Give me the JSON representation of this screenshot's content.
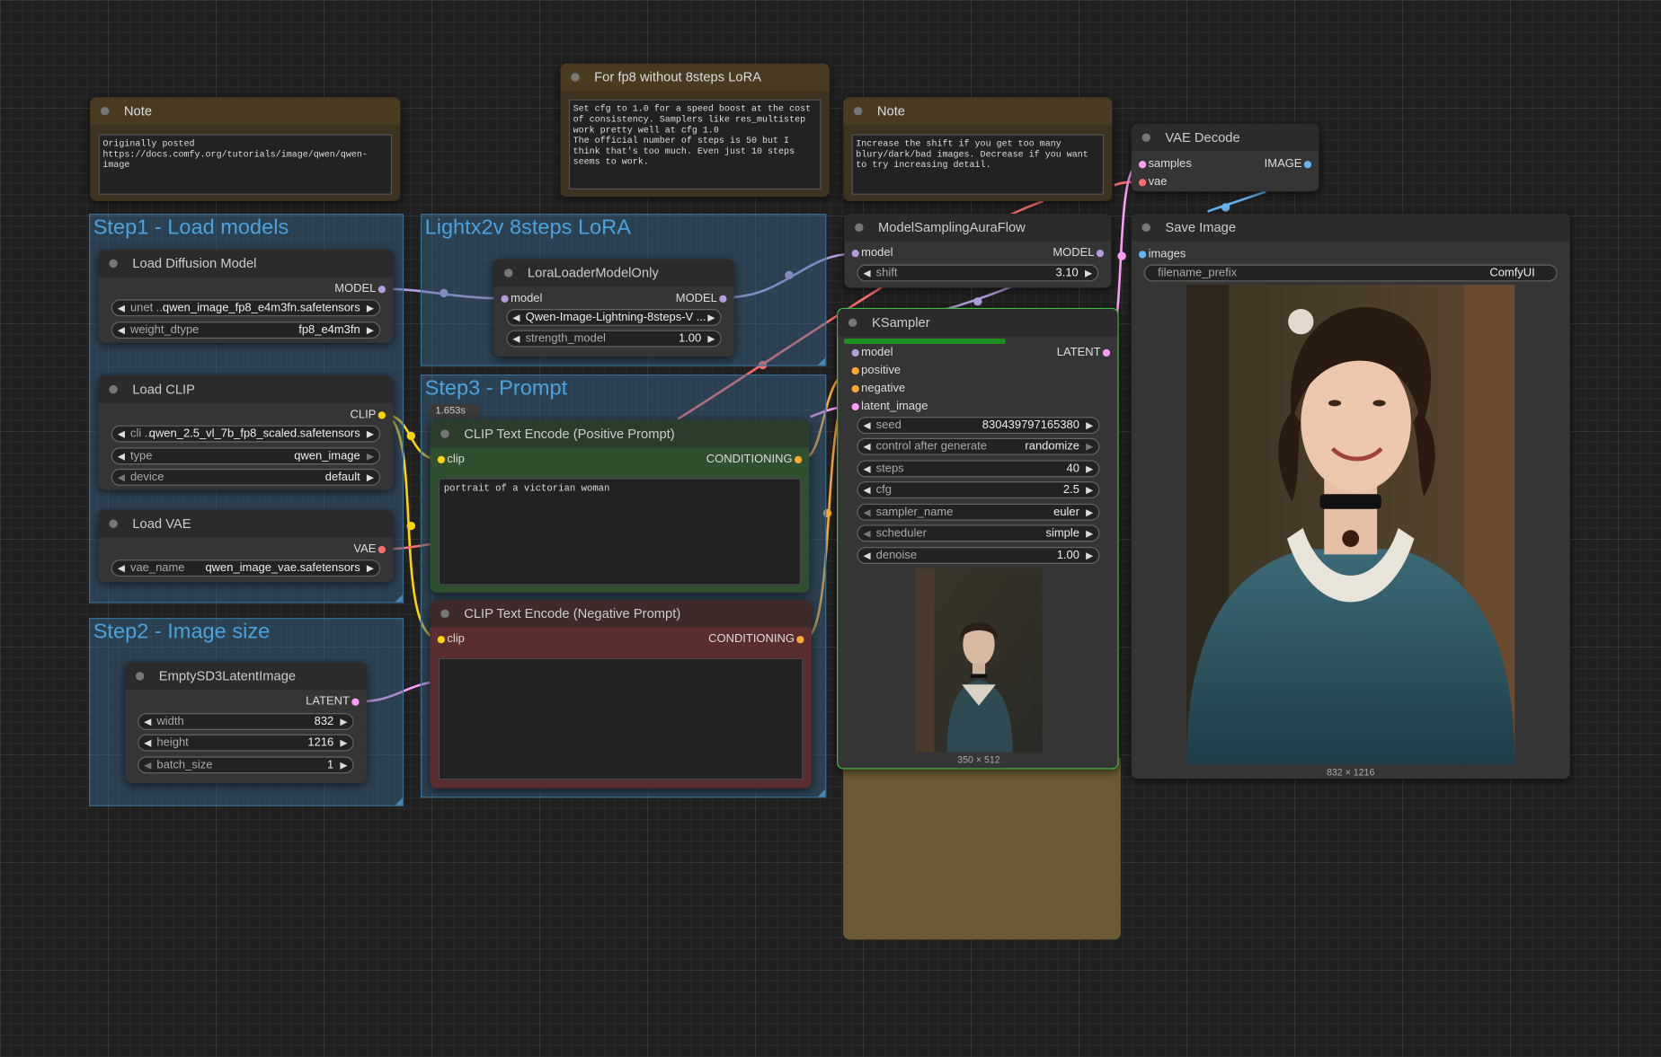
{
  "groups": {
    "step1": "Step1 - Load models",
    "lora": "Lightx2v 8steps LoRA",
    "step3": "Step3 - Prompt",
    "step2": "Step2 - Image size"
  },
  "notes": {
    "note1": {
      "title": "Note",
      "text": "Originally posted\nhttps://docs.comfy.org/tutorials/image/qwen/qwen-image"
    },
    "note2": {
      "title": "For fp8 without 8steps LoRA",
      "text": "Set cfg to 1.0 for a speed boost at the cost\nof consistency. Samplers like res_multistep\nwork pretty well at cfg 1.0\nThe official number of steps is 50 but I\nthink that's too much. Even just 10 steps\nseems to work."
    },
    "note3": {
      "title": "Note",
      "text": "Increase the shift if you get too many\nblury/dark/bad images. Decrease if you want\nto try increasing detail."
    }
  },
  "load_diffusion": {
    "title": "Load Diffusion Model",
    "out": "MODEL",
    "unet_label": "unet ...",
    "unet_value": "qwen_image_fp8_e4m3fn.safetensors",
    "dtype_label": "weight_dtype",
    "dtype_value": "fp8_e4m3fn"
  },
  "load_clip": {
    "title": "Load CLIP",
    "out": "CLIP",
    "clip_label": "cli ...",
    "clip_value": "qwen_2.5_vl_7b_fp8_scaled.safetensors",
    "type_label": "type",
    "type_value": "qwen_image",
    "device_label": "device",
    "device_value": "default"
  },
  "load_vae": {
    "title": "Load VAE",
    "out": "VAE",
    "vae_label": "vae_name",
    "vae_value": "qwen_image_vae.safetensors"
  },
  "latent": {
    "title": "EmptySD3LatentImage",
    "out": "LATENT",
    "width_label": "width",
    "width_value": "832",
    "height_label": "height",
    "height_value": "1216",
    "batch_label": "batch_size",
    "batch_value": "1"
  },
  "lora": {
    "title": "LoraLoaderModelOnly",
    "in": "model",
    "out": "MODEL",
    "lora_value": "Qwen-Image-Lightning-8steps-V ...",
    "strength_label": "strength_model",
    "strength_value": "1.00"
  },
  "timing": "1.653s",
  "positive": {
    "title": "CLIP Text Encode (Positive Prompt)",
    "in": "clip",
    "out": "CONDITIONING",
    "text": "portrait of a victorian woman"
  },
  "negative": {
    "title": "CLIP Text Encode (Negative Prompt)",
    "in": "clip",
    "out": "CONDITIONING",
    "text": ""
  },
  "aura": {
    "title": "ModelSamplingAuraFlow",
    "in": "model",
    "out": "MODEL",
    "shift_label": "shift",
    "shift_value": "3.10"
  },
  "ksampler": {
    "title": "KSampler",
    "out": "LATENT",
    "in_model": "model",
    "in_positive": "positive",
    "in_negative": "negative",
    "in_latent": "latent_image",
    "progress": 0.6,
    "widgets": [
      {
        "label": "seed",
        "value": "830439797165380"
      },
      {
        "label": "control after generate",
        "value": "randomize"
      },
      {
        "label": "steps",
        "value": "40"
      },
      {
        "label": "cfg",
        "value": "2.5"
      },
      {
        "label": "sampler_name",
        "value": "euler"
      },
      {
        "label": "scheduler",
        "value": "simple"
      },
      {
        "label": "denoise",
        "value": "1.00"
      }
    ],
    "preview_caption": "350 × 512"
  },
  "vae_decode": {
    "title": "VAE Decode",
    "in_samples": "samples",
    "in_vae": "vae",
    "out": "IMAGE"
  },
  "save_image": {
    "title": "Save Image",
    "in": "images",
    "prefix_label": "filename_prefix",
    "prefix_value": "ComfyUI",
    "caption": "832 × 1216"
  },
  "colors": {
    "model": "#b39ddb",
    "clip": "#ffd500",
    "vae": "#ff6e6e",
    "latent": "#ff9cf9",
    "conditioning": "#ffa931",
    "image": "#64b5f6"
  }
}
